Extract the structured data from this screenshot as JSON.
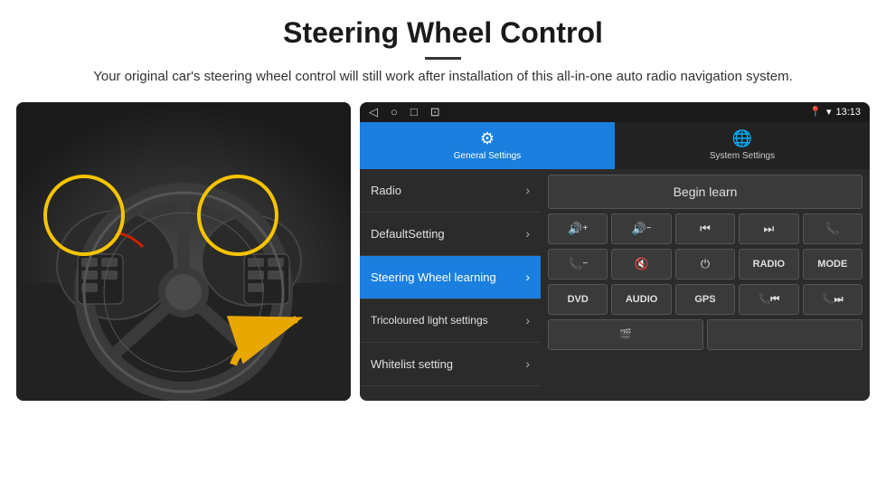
{
  "header": {
    "title": "Steering Wheel Control",
    "subtitle": "Your original car's steering wheel control will still work after installation of this all-in-one auto radio navigation system.",
    "divider": true
  },
  "statusBar": {
    "time": "13:13",
    "icons": [
      "◁",
      "○",
      "□",
      "⊡"
    ]
  },
  "tabs": [
    {
      "label": "General Settings",
      "icon": "⚙",
      "active": true
    },
    {
      "label": "System Settings",
      "icon": "🌐",
      "active": false
    }
  ],
  "menuItems": [
    {
      "label": "Radio",
      "active": false
    },
    {
      "label": "DefaultSetting",
      "active": false
    },
    {
      "label": "Steering Wheel learning",
      "active": true
    },
    {
      "label": "Tricoloured light settings",
      "active": false
    },
    {
      "label": "Whitelist setting",
      "active": false
    }
  ],
  "rightPanel": {
    "beginLearnLabel": "Begin learn",
    "row1": [
      "🔊+",
      "🔊−",
      "⏮",
      "⏭",
      "📞"
    ],
    "row2": [
      "📞−",
      "🔇",
      "⏻",
      "RADIO",
      "MODE"
    ],
    "row3": [
      "DVD",
      "AUDIO",
      "GPS",
      "📞⏮",
      "📞⏭"
    ],
    "row4": [
      "🎬",
      ""
    ]
  }
}
